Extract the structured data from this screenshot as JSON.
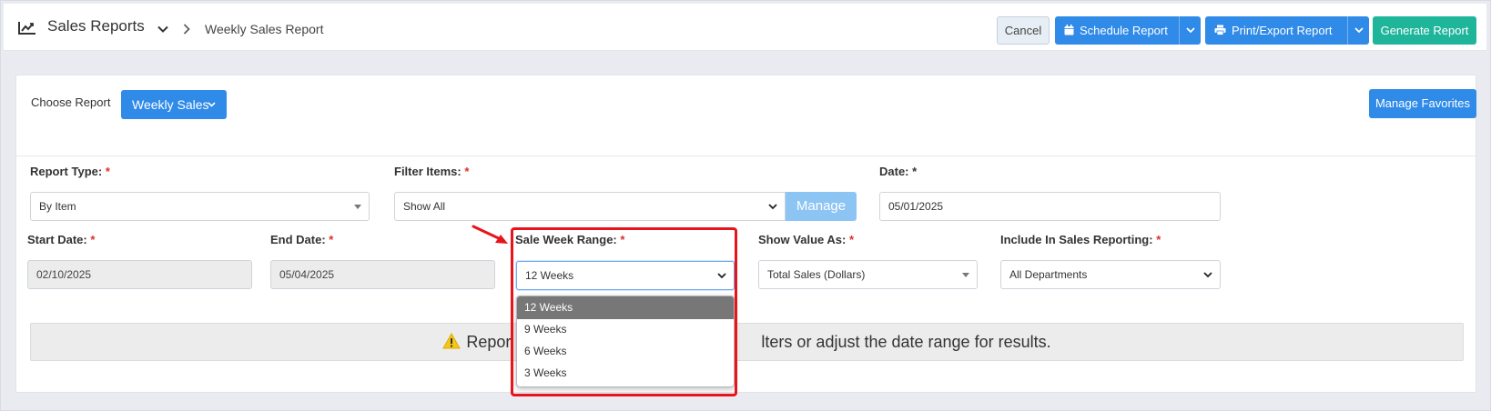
{
  "header": {
    "title": "Sales Reports",
    "breadcrumb_current": "Weekly Sales Report",
    "buttons": {
      "cancel": "Cancel",
      "schedule": "Schedule Report",
      "print_export": "Print/Export Report",
      "generate": "Generate Report"
    }
  },
  "report_chooser": {
    "label": "Choose Report",
    "selected": "Weekly Sales",
    "manage_favorites": "Manage Favorites"
  },
  "form": {
    "report_type": {
      "label": "Report Type:",
      "required": "*",
      "value": "By Item"
    },
    "filter_items": {
      "label": "Filter Items:",
      "required": "*",
      "value": "Show All",
      "manage": "Manage"
    },
    "date": {
      "label": "Date: *",
      "value": "05/01/2025"
    },
    "start_date": {
      "label": "Start Date:",
      "required": "*",
      "value": "02/10/2025"
    },
    "end_date": {
      "label": "End Date:",
      "required": "*",
      "value": "05/04/2025"
    },
    "sale_week_range": {
      "label": "Sale Week Range:",
      "required": "*",
      "value": "12 Weeks",
      "options": [
        "12 Weeks",
        "9 Weeks",
        "6 Weeks",
        "3 Weeks"
      ]
    },
    "show_value_as": {
      "label": "Show Value As:",
      "required": "*",
      "value": "Total Sales (Dollars)"
    },
    "include_in_sales": {
      "label": "Include In Sales Reporting:",
      "required": "*",
      "value": "All Departments"
    }
  },
  "alert": {
    "text_left": "Repor",
    "text_right": "lters or adjust the date range for results."
  },
  "colors": {
    "primary": "#2f8ae8",
    "teal": "#1fb59b",
    "highlight": "#e8131b",
    "required": "#d9322b"
  }
}
